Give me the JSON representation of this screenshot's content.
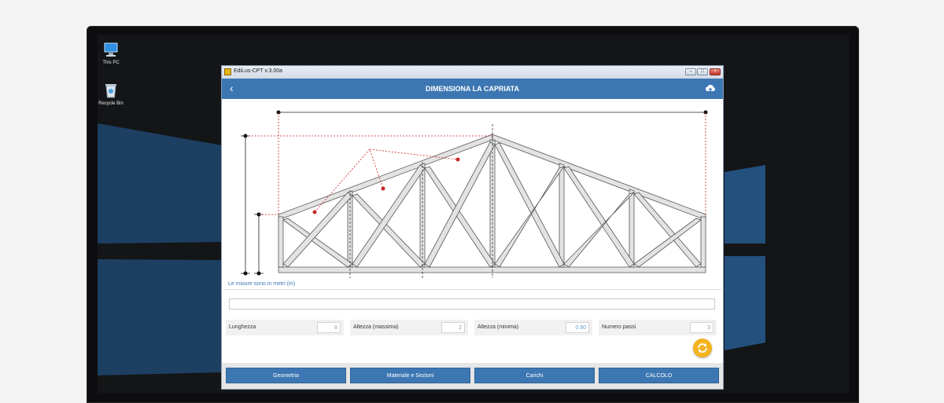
{
  "desktop": {
    "icons": [
      {
        "label": "This PC",
        "icon": "computer-icon"
      },
      {
        "label": "Recycle Bin",
        "icon": "recycle-bin-icon"
      }
    ]
  },
  "window": {
    "title": "EdiLus-CPT v.3.00a",
    "controls": [
      "minimize",
      "maximize",
      "close"
    ]
  },
  "header": {
    "back_symbol": "‹",
    "title": "DIMENSIONA LA CAPRIATA",
    "cloud_icon": "cloud-upload-icon"
  },
  "drawing": {
    "units_note": "Le misure sono in metri (m)"
  },
  "long_field": {
    "value": ""
  },
  "params": [
    {
      "label": "Lunghezza",
      "value": "8"
    },
    {
      "label": "Altezza (massima)",
      "value": "2"
    },
    {
      "label": "Altezza (minima)",
      "value": "0.80"
    },
    {
      "label": "Numero passi",
      "value": "3"
    }
  ],
  "tabs": [
    {
      "label": "Geometria"
    },
    {
      "label": "Materiale e Sezioni"
    },
    {
      "label": "Carichi"
    },
    {
      "label": "CALCOLO"
    }
  ],
  "colors": {
    "accent": "#3d77b3",
    "refresh": "#f4b31f",
    "highlight_value": "#6a9fd6"
  }
}
